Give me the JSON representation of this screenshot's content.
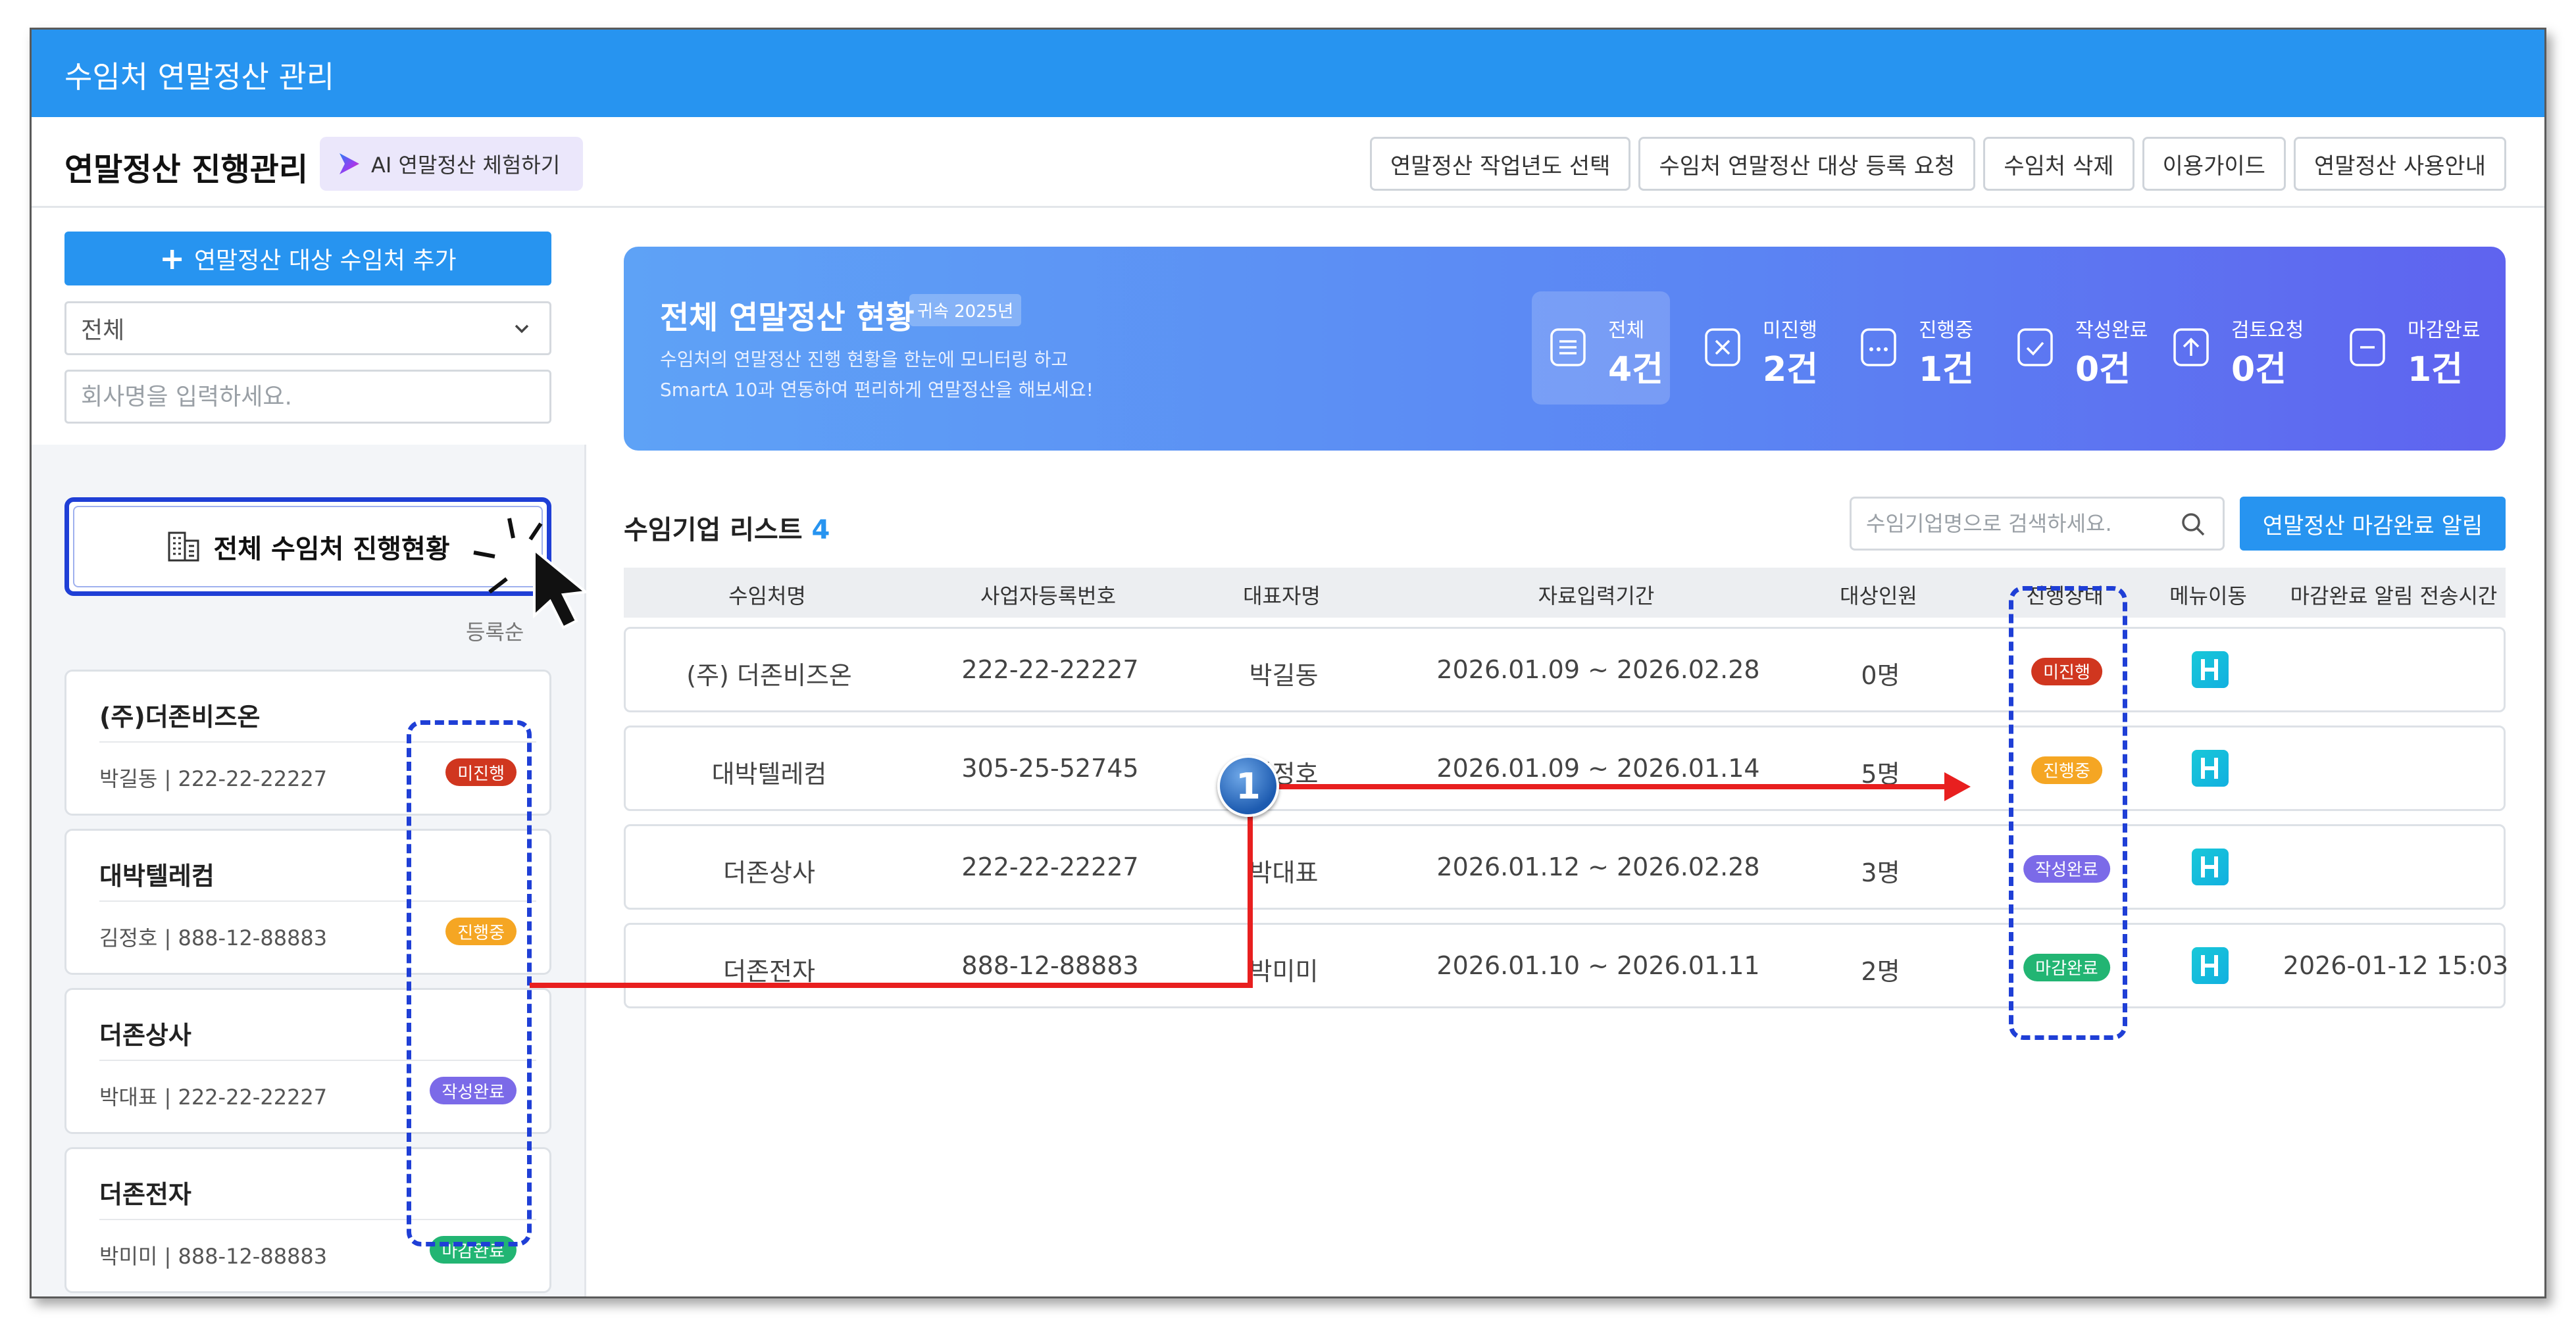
{
  "app": {
    "title": "수임처 연말정산 관리"
  },
  "header": {
    "page_title": "연말정산 진행관리",
    "ai_button": "AI 연말정산 체험하기",
    "buttons": [
      "연말정산 작업년도 선택",
      "수임처 연말정산 대상 등록 요청",
      "수임처 삭제",
      "이용가이드",
      "연말정산 사용안내"
    ]
  },
  "sidebar": {
    "add_button": "연말정산 대상 수임처 추가",
    "filter_value": "전체",
    "company_placeholder": "회사명을 입력하세요.",
    "status_button": "전체 수임처 진행현황",
    "sort_label": "등록순",
    "cards": [
      {
        "name": "(주)더존비즈온",
        "rep": "박길동",
        "bizno": "222-22-22227",
        "status": "미진행",
        "color": "#d0361f"
      },
      {
        "name": "대박텔레컴",
        "rep": "김정호",
        "bizno": "888-12-88883",
        "status": "진행중",
        "color": "#f5a623"
      },
      {
        "name": "더존상사",
        "rep": "박대표",
        "bizno": "222-22-22227",
        "status": "작성완료",
        "color": "#7b6ae8"
      },
      {
        "name": "더존전자",
        "rep": "박미미",
        "bizno": "888-12-88883",
        "status": "마감완료",
        "color": "#22b573"
      }
    ]
  },
  "banner": {
    "title": "전체 연말정산 현황",
    "year": "귀속 2025년",
    "desc1": "수임처의 연말정산 진행 현황을 한눈에 모니터링 하고",
    "desc2": "SmartA 10과 연동하여 편리하게 연말정산을 해보세요!",
    "stats": [
      {
        "label": "전체",
        "value": "4건",
        "icon": "list-icon"
      },
      {
        "label": "미진행",
        "value": "2건",
        "icon": "x-box-icon"
      },
      {
        "label": "진행중",
        "value": "1건",
        "icon": "dots-box-icon"
      },
      {
        "label": "작성완료",
        "value": "0건",
        "icon": "check-box-icon"
      },
      {
        "label": "검토요청",
        "value": "0건",
        "icon": "upload-icon"
      },
      {
        "label": "마감완료",
        "value": "1건",
        "icon": "minus-box-icon"
      }
    ]
  },
  "list": {
    "title": "수임기업 리스트",
    "count": "4",
    "search_placeholder": "수임기업명으로 검색하세요.",
    "notify_button": "연말정산 마감완료 알림",
    "columns": [
      "수임처명",
      "사업자등록번호",
      "대표자명",
      "자료입력기간",
      "대상인원",
      "진행상태",
      "메뉴이동",
      "마감완료 알림 전송시간"
    ],
    "rows": [
      {
        "name": "(주) 더존비즈온",
        "bizno": "222-22-22227",
        "rep": "박길동",
        "period": "2026.01.09 ~ 2026.02.28",
        "people": "0명",
        "status": "미진행",
        "color": "#d0361f",
        "sent": ""
      },
      {
        "name": "대박텔레컴",
        "bizno": "305-25-52745",
        "rep": "김정호",
        "period": "2026.01.09 ~ 2026.01.14",
        "people": "5명",
        "status": "진행중",
        "color": "#f5a623",
        "sent": ""
      },
      {
        "name": "더존상사",
        "bizno": "222-22-22227",
        "rep": "박대표",
        "period": "2026.01.12 ~ 2026.02.28",
        "people": "3명",
        "status": "작성완료",
        "color": "#7b6ae8",
        "sent": ""
      },
      {
        "name": "더존전자",
        "bizno": "888-12-88883",
        "rep": "박미미",
        "period": "2026.01.10 ~ 2026.01.11",
        "people": "2명",
        "status": "마감완료",
        "color": "#22b573",
        "sent": "2026-01-12 15:03"
      }
    ]
  },
  "annotation": {
    "callout_number": "1",
    "arrow_color": "#e81f1f",
    "highlight_color": "#1f3fd6"
  }
}
